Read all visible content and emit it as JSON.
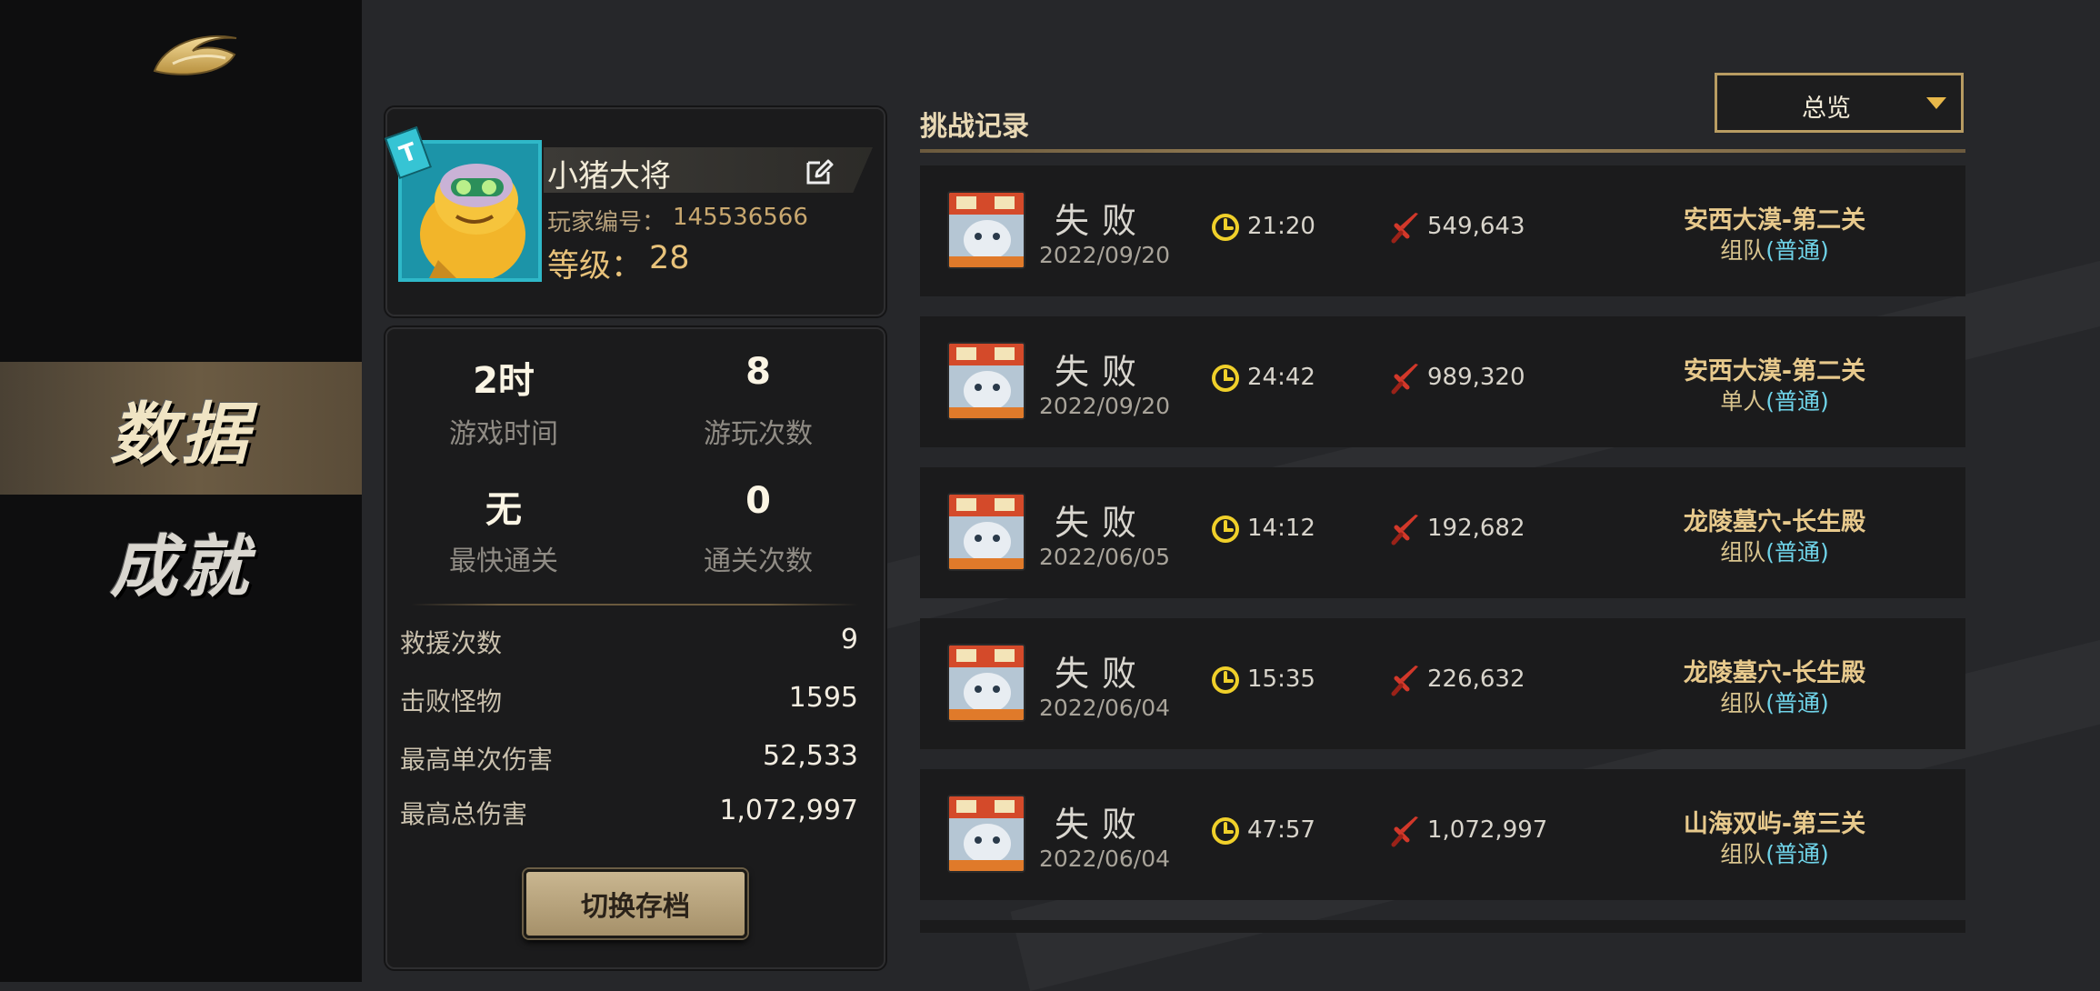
{
  "sidebar": {
    "back_icon": "return-swoosh-icon",
    "nav": [
      {
        "label": "数据",
        "active": true
      },
      {
        "label": "成就",
        "active": false
      }
    ]
  },
  "profile": {
    "name": "小猪大将",
    "id_label": "玩家编号：",
    "id": "145536566",
    "level_label": "等级：",
    "level": "28",
    "avatar_tag": "T",
    "frame_color": "#2fb8c8"
  },
  "stats": {
    "play_time": {
      "value": "2时",
      "label": "游戏时间"
    },
    "play_count": {
      "value": "8",
      "label": "游玩次数"
    },
    "fastest_clear": {
      "value": "无",
      "label": "最快通关"
    },
    "clear_count": {
      "value": "0",
      "label": "通关次数"
    },
    "rows": [
      {
        "label": "救援次数",
        "value": "9"
      },
      {
        "label": "击败怪物",
        "value": "1595"
      },
      {
        "label": "最高单次伤害",
        "value": "52,533"
      },
      {
        "label": "最高总伤害",
        "value": "1,072,997"
      }
    ],
    "switch_label": "切换存档"
  },
  "records": {
    "title": "挑战记录",
    "filter": "总览",
    "items": [
      {
        "result": "失败",
        "date": "2022/09/20",
        "time": "21:20",
        "damage": "549,643",
        "stage": "安西大漠-第二关",
        "mode": "组队",
        "difficulty": "(普通)"
      },
      {
        "result": "失败",
        "date": "2022/09/20",
        "time": "24:42",
        "damage": "989,320",
        "stage": "安西大漠-第二关",
        "mode": "单人",
        "difficulty": "(普通)"
      },
      {
        "result": "失败",
        "date": "2022/06/05",
        "time": "14:12",
        "damage": "192,682",
        "stage": "龙陵墓穴-长生殿",
        "mode": "组队",
        "difficulty": "(普通)"
      },
      {
        "result": "失败",
        "date": "2022/06/04",
        "time": "15:35",
        "damage": "226,632",
        "stage": "龙陵墓穴-长生殿",
        "mode": "组队",
        "difficulty": "(普通)"
      },
      {
        "result": "失败",
        "date": "2022/06/04",
        "time": "47:57",
        "damage": "1,072,997",
        "stage": "山海双屿-第三关",
        "mode": "组队",
        "difficulty": "(普通)"
      }
    ]
  },
  "colors": {
    "accent_gold": "#e8c27a",
    "difficulty_cyan": "#6fd3e8",
    "clock_yellow": "#f0d02a",
    "sword_red": "#d2382a"
  }
}
